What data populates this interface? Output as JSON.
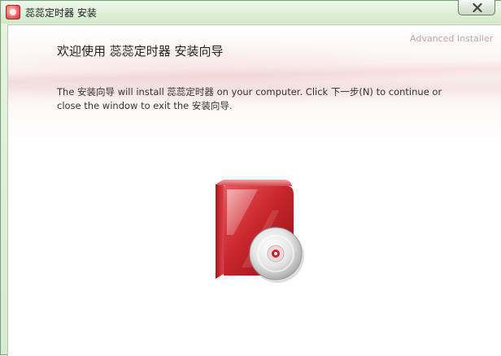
{
  "window": {
    "title": "蕊蕊定时器 安装"
  },
  "header": {
    "brand": "Advanced Installer",
    "title": "欢迎使用  蕊蕊定时器  安装向导"
  },
  "main": {
    "description": "The 安装向导  will install 蕊蕊定时器  on your computer. Click 下一步(N) to continue or close the window to exit the 安装向导."
  },
  "icons": {
    "app": "app-icon",
    "close": "close-icon",
    "product": "installer-box-icon"
  },
  "colors": {
    "titlebar": "#dff0d8",
    "brand_text": "#c9a4a4",
    "box_red": "#c0282c"
  }
}
